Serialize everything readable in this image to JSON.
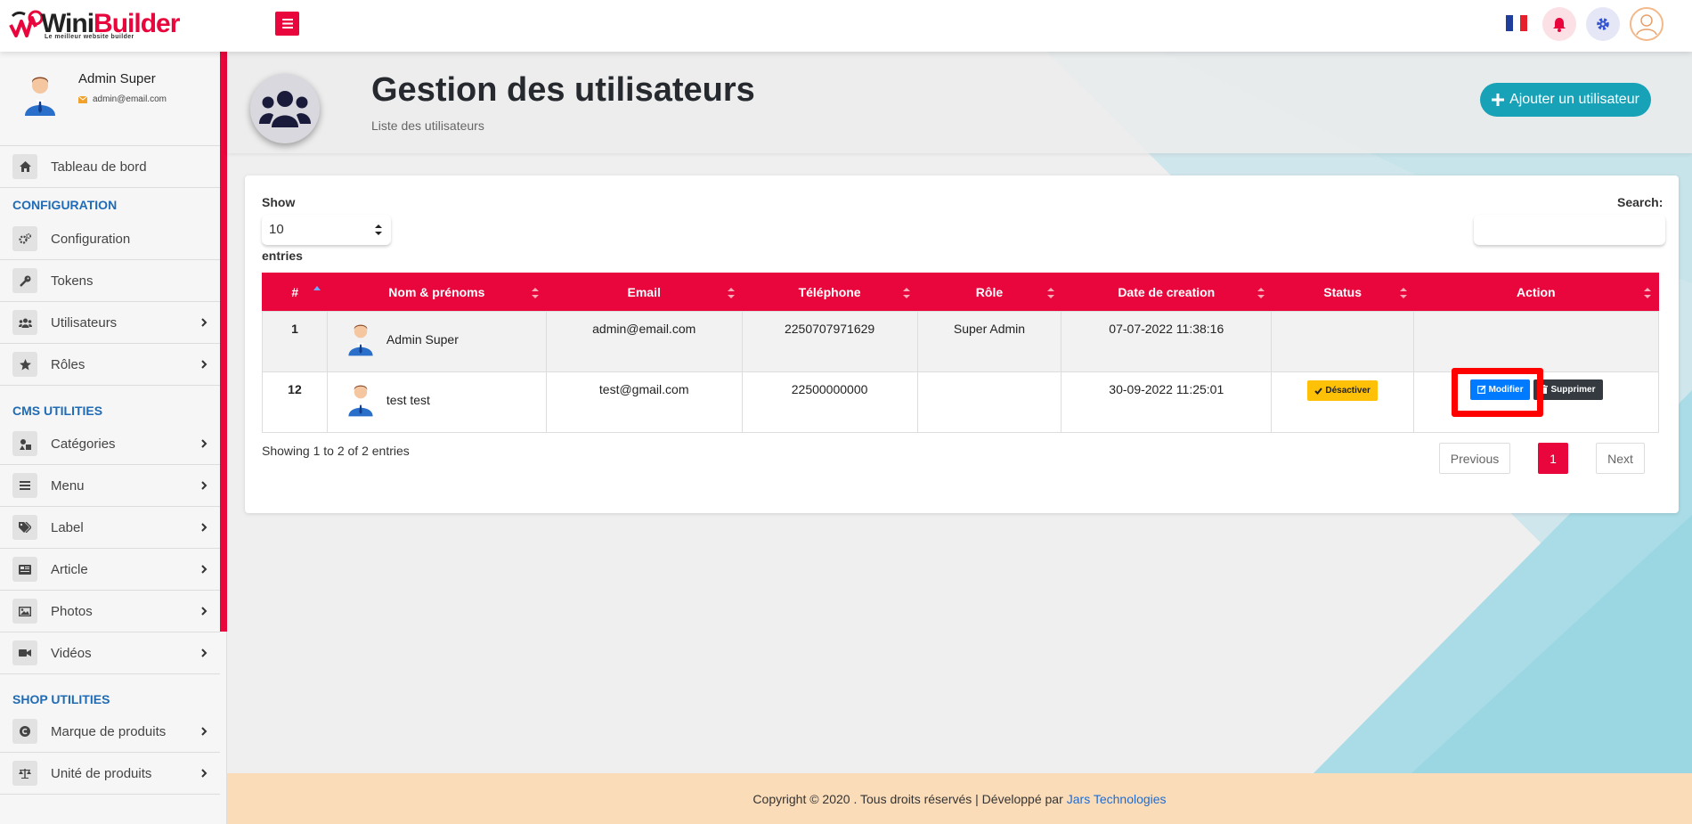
{
  "brand": {
    "name_part1": "Wini",
    "name_part2": "Builder",
    "tagline": "Le meilleur website builder",
    "accent": "#e8063c"
  },
  "topbar": {
    "menu_icon": "bars-icon",
    "language": "fr",
    "bell_icon": "bell-icon",
    "settings_icon": "gear-icon",
    "user_icon": "user-avatar"
  },
  "profile": {
    "name": "Admin Super",
    "email": "admin@email.com"
  },
  "sidebar": {
    "dashboard": "Tableau de bord",
    "section_config": "CONFIGURATION",
    "config_items": [
      "Configuration",
      "Tokens",
      "Utilisateurs",
      "Rôles"
    ],
    "section_cms": "CMS UTILITIES",
    "cms_items": [
      "Catégories",
      "Menu",
      "Label",
      "Article",
      "Photos",
      "Vidéos"
    ],
    "section_shop": "SHOP UTILITIES",
    "shop_items": [
      "Marque de produits",
      "Unité de produits"
    ]
  },
  "header": {
    "title": "Gestion des utilisateurs",
    "subtitle": "Liste des utilisateurs",
    "add_button": "Ajouter un utilisateur"
  },
  "table_controls": {
    "show_label": "Show",
    "page_length": "10",
    "entries_label": "entries",
    "search_label": "Search:"
  },
  "table": {
    "columns": [
      "#",
      "Nom & prénoms",
      "Email",
      "Téléphone",
      "Rôle",
      "Date de creation",
      "Status",
      "Action"
    ],
    "rows": [
      {
        "id": "1",
        "name": "Admin Super",
        "email": "admin@email.com",
        "phone": "2250707971629",
        "role": "Super Admin",
        "created": "07-07-2022 11:38:16"
      },
      {
        "id": "12",
        "name": "test test",
        "email": "test@gmail.com",
        "phone": "22500000000",
        "role": "",
        "created": "30-09-2022 11:25:01",
        "status_button": "Désactiver",
        "edit_button": "Modifier",
        "delete_button": "Supprimer"
      }
    ]
  },
  "pagination": {
    "info": "Showing 1 to 2 of 2 entries",
    "previous": "Previous",
    "current": "1",
    "next": "Next"
  },
  "footer": {
    "text": "Copyright © 2020 . Tous droits réservés | Développé par",
    "link": "Jars Technologies"
  }
}
